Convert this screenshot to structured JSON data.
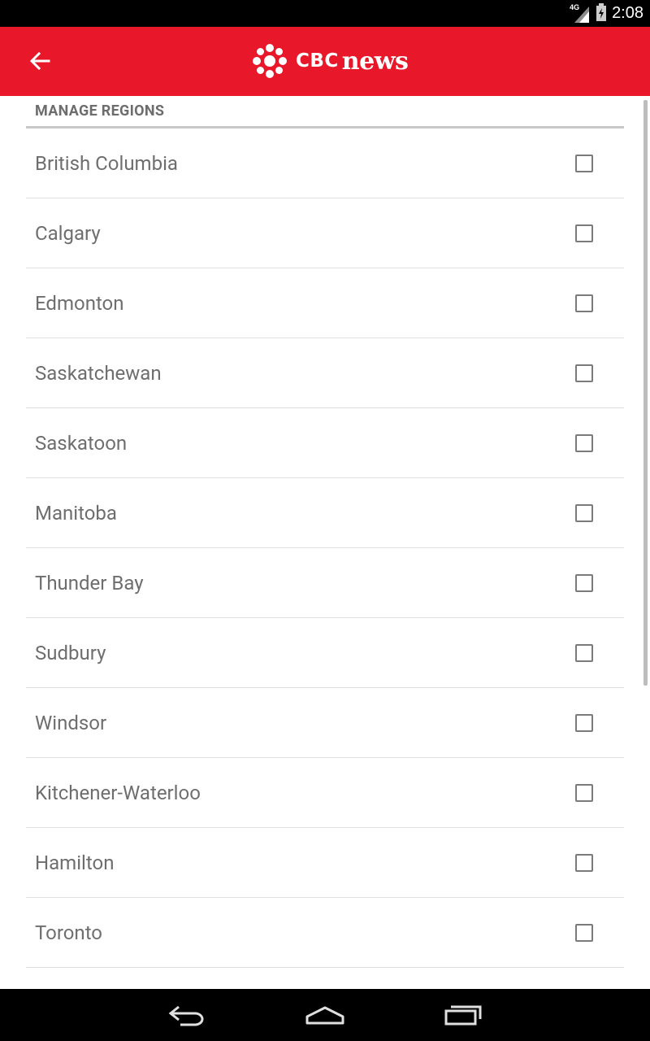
{
  "status_bar": {
    "network": "4G",
    "time": "2:08"
  },
  "app_bar": {
    "logo_cbc": "CBC",
    "logo_news": "news"
  },
  "section": {
    "title": "MANAGE REGIONS"
  },
  "regions": [
    {
      "label": "British Columbia",
      "checked": false
    },
    {
      "label": "Calgary",
      "checked": false
    },
    {
      "label": "Edmonton",
      "checked": false
    },
    {
      "label": "Saskatchewan",
      "checked": false
    },
    {
      "label": "Saskatoon",
      "checked": false
    },
    {
      "label": "Manitoba",
      "checked": false
    },
    {
      "label": "Thunder Bay",
      "checked": false
    },
    {
      "label": "Sudbury",
      "checked": false
    },
    {
      "label": "Windsor",
      "checked": false
    },
    {
      "label": "Kitchener-Waterloo",
      "checked": false
    },
    {
      "label": "Hamilton",
      "checked": false
    },
    {
      "label": "Toronto",
      "checked": false
    }
  ],
  "colors": {
    "brand_red": "#e8182a",
    "text_gray": "#6e6e6e"
  },
  "icons": [
    "back-arrow-icon",
    "cbc-gem-icon",
    "signal-icon",
    "battery-icon",
    "nav-back-icon",
    "nav-home-icon",
    "nav-recents-icon"
  ]
}
